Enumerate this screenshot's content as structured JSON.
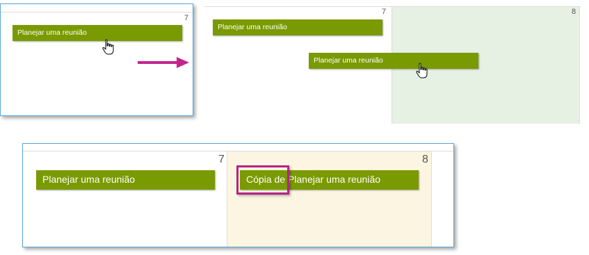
{
  "colors": {
    "event": "#7a9a01",
    "selected_day_green": "#e6f0e3",
    "selected_day_cream": "#fcf5e1",
    "arrow": "#c2258e",
    "frame": "#5aa6d6"
  },
  "step1": {
    "day_number": "7",
    "event_label": "Planejar uma reunião"
  },
  "step2": {
    "day7_number": "7",
    "day8_number": "8",
    "event_original_label": "Planejar uma reunião",
    "event_dragged_label": "Planejar uma reunião"
  },
  "step3": {
    "day7_number": "7",
    "day8_number": "8",
    "event_original_label": "Planejar uma reunião",
    "event_copy_label": "Cópia de Planejar uma reunião"
  },
  "icons": {
    "cursor": "hand-pointer-icon",
    "arrow": "arrow-right-icon"
  }
}
